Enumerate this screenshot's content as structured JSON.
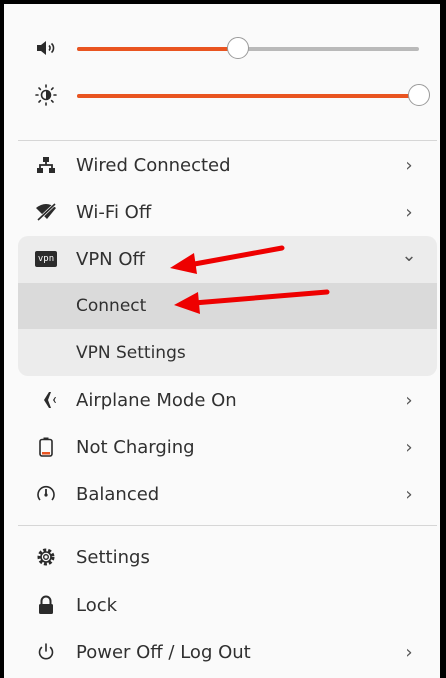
{
  "sliders": {
    "volume": {
      "icon": "speaker-icon",
      "value_percent": 47
    },
    "brightness": {
      "icon": "brightness-icon",
      "value_percent": 100
    }
  },
  "network": {
    "wired": {
      "icon": "wired-network-icon",
      "label": "Wired Connected"
    },
    "wifi": {
      "icon": "wifi-off-icon",
      "label": "Wi-Fi Off"
    },
    "vpn": {
      "icon": "vpn-icon",
      "icon_text": "vpn",
      "label": "VPN Off",
      "expanded": true,
      "items": [
        {
          "label": "Connect",
          "highlighted": true
        },
        {
          "label": "VPN Settings",
          "highlighted": false
        }
      ]
    },
    "airplane": {
      "icon": "airplane-icon",
      "label": "Airplane Mode On"
    }
  },
  "power": {
    "battery": {
      "icon": "battery-icon",
      "label": "Not Charging"
    },
    "profile": {
      "icon": "power-profile-icon",
      "label": "Balanced"
    }
  },
  "system": {
    "settings": {
      "icon": "gear-icon",
      "label": "Settings"
    },
    "lock": {
      "icon": "lock-icon",
      "label": "Lock"
    },
    "poweroff": {
      "icon": "power-icon",
      "label": "Power Off / Log Out"
    }
  },
  "chevrons": {
    "right": "›",
    "down": "⌄"
  },
  "colors": {
    "accent": "#e95420",
    "annotation": "#ee0000"
  },
  "annotations": [
    {
      "points_to": "VPN Off"
    },
    {
      "points_to": "Connect"
    }
  ]
}
